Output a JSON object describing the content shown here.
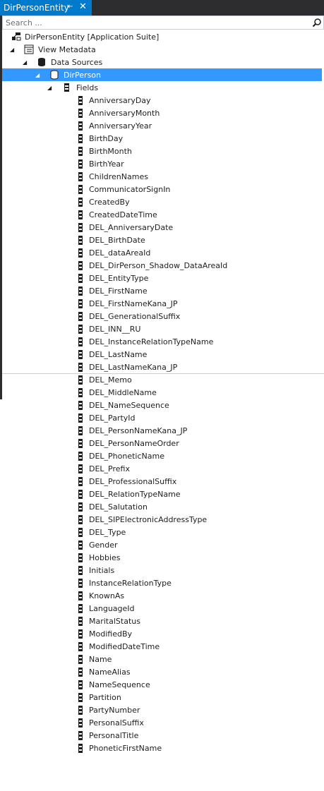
{
  "tab": {
    "title": "DirPersonEntity",
    "pin_glyph": "⇤",
    "close_glyph": "✕"
  },
  "search": {
    "placeholder": "Search ..."
  },
  "tree": {
    "root": "DirPersonEntity [Application Suite]",
    "view_metadata": "View Metadata",
    "data_sources": "Data Sources",
    "selected_node": "DirPerson",
    "fields_node": "Fields",
    "fields": [
      "AnniversaryDay",
      "AnniversaryMonth",
      "AnniversaryYear",
      "BirthDay",
      "BirthMonth",
      "BirthYear",
      "ChildrenNames",
      "CommunicatorSignIn",
      "CreatedBy",
      "CreatedDateTime",
      "DEL_AnniversaryDate",
      "DEL_BirthDate",
      "DEL_dataAreaId",
      "DEL_DirPerson_Shadow_DataAreaId",
      "DEL_EntityType",
      "DEL_FirstName",
      "DEL_FirstNameKana_JP",
      "DEL_GenerationalSuffix",
      "DEL_INN__RU",
      "DEL_InstanceRelationTypeName",
      "DEL_LastName",
      "DEL_LastNameKana_JP",
      "DEL_Memo",
      "DEL_MiddleName",
      "DEL_NameSequence",
      "DEL_PartyId",
      "DEL_PersonNameKana_JP",
      "DEL_PersonNameOrder",
      "DEL_PhoneticName",
      "DEL_Prefix",
      "DEL_ProfessionalSuffix",
      "DEL_RelationTypeName",
      "DEL_Salutation",
      "DEL_SIPElectronicAddressType",
      "DEL_Type",
      "Gender",
      "Hobbies",
      "Initials",
      "InstanceRelationType",
      "KnownAs",
      "LanguageId",
      "MaritalStatus",
      "ModifiedBy",
      "ModifiedDateTime",
      "Name",
      "NameAlias",
      "NameSequence",
      "Partition",
      "PartyNumber",
      "PersonalSuffix",
      "PersonalTitle",
      "PhoneticFirstName"
    ]
  },
  "colors": {
    "accent": "#007acc",
    "selection": "#3399ff",
    "chrome": "#2d2d30"
  }
}
